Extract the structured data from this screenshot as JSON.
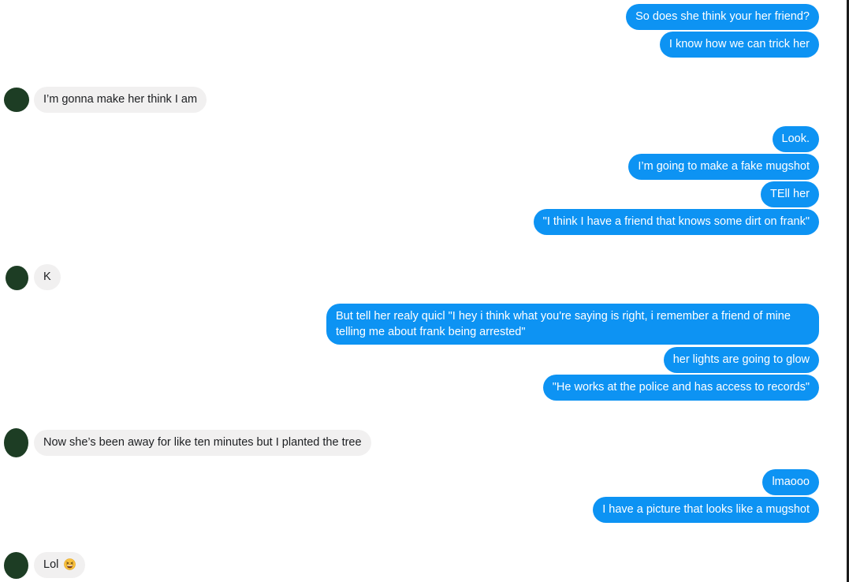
{
  "conversation": {
    "messages": [
      {
        "sender": "me",
        "text": "So does she think your her friend?"
      },
      {
        "sender": "me",
        "text": "I know how we can trick her"
      },
      {
        "sender": "other",
        "text": "I’m gonna make her think I am"
      },
      {
        "sender": "me",
        "text": "Look."
      },
      {
        "sender": "me",
        "text": "I’m going to make a fake mugshot"
      },
      {
        "sender": "me",
        "text": "TEll her"
      },
      {
        "sender": "me",
        "text": "\"I think I have a friend that knows some dirt on frank\""
      },
      {
        "sender": "other",
        "text": "K"
      },
      {
        "sender": "me",
        "text": "But tell her realy quicl \"I hey i think what you're saying is right, i remember a friend of mine telling me about frank being arrested\""
      },
      {
        "sender": "me",
        "text": "her lights are going to glow"
      },
      {
        "sender": "me",
        "text": "\"He works at the police and has access to records\""
      },
      {
        "sender": "other",
        "text": "Now she’s been away for like ten minutes but I planted the tree"
      },
      {
        "sender": "me",
        "text": "lmaooo"
      },
      {
        "sender": "me",
        "text": "I have a picture that looks like a mugshot"
      },
      {
        "sender": "other",
        "text": "Lol",
        "emoji": "grinning-squinting-face-icon"
      }
    ]
  },
  "colors": {
    "outgoing_bubble": "#0d93f3",
    "incoming_bubble": "#f1f0f0",
    "avatar": "#1d3d24"
  }
}
